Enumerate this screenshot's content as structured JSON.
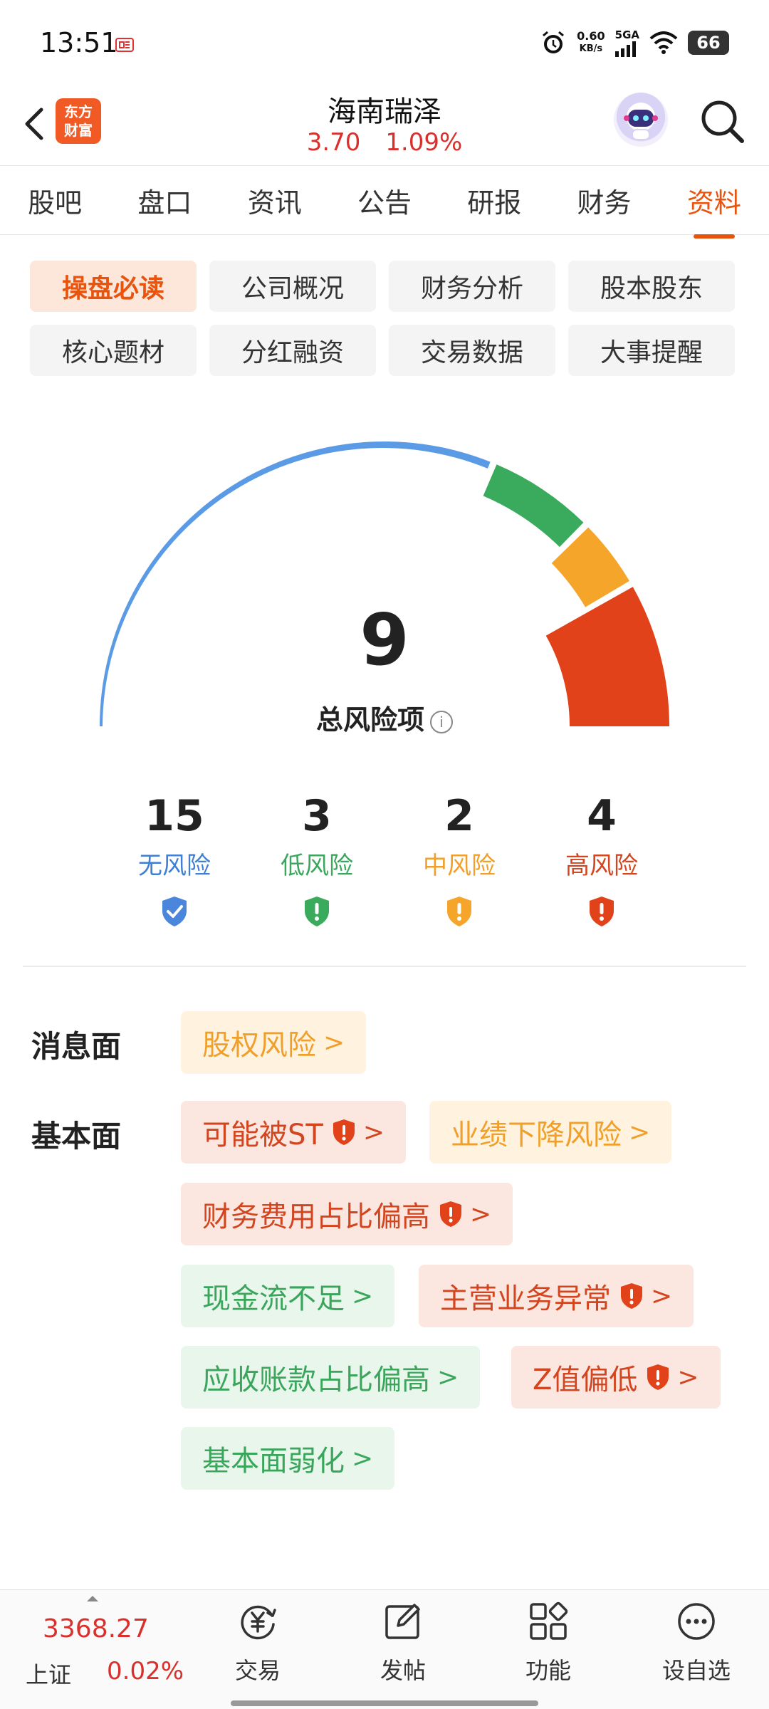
{
  "status_bar": {
    "time": "13:51",
    "net_speed_value": "0.60",
    "net_speed_unit": "KB/s",
    "signal": "5GA",
    "battery": "66"
  },
  "header": {
    "brand_line1": "东方",
    "brand_line2": "财富",
    "stock_name": "海南瑞泽",
    "price": "3.70",
    "change_pct": "1.09%"
  },
  "tabs": [
    {
      "label": "股吧"
    },
    {
      "label": "盘口"
    },
    {
      "label": "资讯"
    },
    {
      "label": "公告"
    },
    {
      "label": "研报"
    },
    {
      "label": "财务"
    },
    {
      "label": "资料"
    }
  ],
  "sub_menu": [
    {
      "label": "操盘必读"
    },
    {
      "label": "公司概况"
    },
    {
      "label": "财务分析"
    },
    {
      "label": "股本股东"
    },
    {
      "label": "核心题材"
    },
    {
      "label": "分红融资"
    },
    {
      "label": "交易数据"
    },
    {
      "label": "大事提醒"
    }
  ],
  "gauge": {
    "total": "9",
    "label": "总风险项",
    "info_symbol": "i",
    "colors": {
      "none": "#5b9be6",
      "low": "#3aaa5c",
      "mid": "#f5a62a",
      "high": "#e2421a"
    }
  },
  "risk_counts": [
    {
      "count": "15",
      "name": "无风险",
      "color": "#3f7fd4"
    },
    {
      "count": "3",
      "name": "低风险",
      "color": "#3aa65c"
    },
    {
      "count": "2",
      "name": "中风险",
      "color": "#f0a02a"
    },
    {
      "count": "4",
      "name": "高风险",
      "color": "#d2451f"
    }
  ],
  "news_section": {
    "label": "消息面",
    "tags": [
      {
        "text": "股权风险",
        "level": "mid"
      }
    ]
  },
  "fundamental_section": {
    "label": "基本面",
    "tags": [
      {
        "text": "可能被ST",
        "level": "high"
      },
      {
        "text": "业绩下降风险",
        "level": "mid"
      },
      {
        "text": "财务费用占比偏高",
        "level": "high"
      },
      {
        "text": "现金流不足",
        "level": "low"
      },
      {
        "text": "主营业务异常",
        "level": "high"
      },
      {
        "text": "应收账款占比偏高",
        "level": "low"
      },
      {
        "text": "Z值偏低",
        "level": "high"
      },
      {
        "text": "基本面弱化",
        "level": "low"
      }
    ]
  },
  "chevron": ">",
  "bottom_bar": {
    "index_value": "3368.27",
    "index_name": "上证",
    "index_change": "0.02%",
    "nav": [
      {
        "label": "交易",
        "icon": "yuan-refresh-icon"
      },
      {
        "label": "发帖",
        "icon": "edit-icon"
      },
      {
        "label": "功能",
        "icon": "grid-icon"
      },
      {
        "label": "设自选",
        "icon": "more-icon"
      }
    ]
  }
}
